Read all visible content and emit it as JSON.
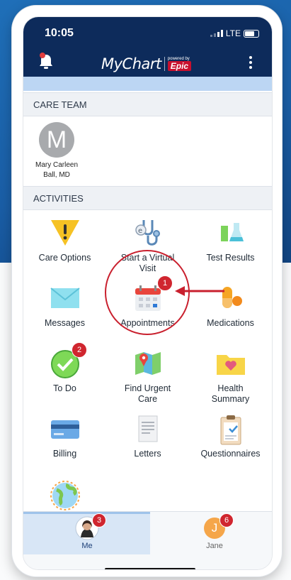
{
  "status_bar": {
    "time": "10:05",
    "carrier": "LTE"
  },
  "header": {
    "logo_text": "MyChart",
    "powered_by": "powered by",
    "brand": "Epic"
  },
  "care_team": {
    "section_label": "CARE TEAM",
    "members": [
      {
        "initial": "M",
        "name": "Mary Carleen Ball, MD"
      }
    ]
  },
  "activities": {
    "section_label": "ACTIVITIES",
    "items": [
      {
        "label": "Care Options",
        "icon": "warning-icon"
      },
      {
        "label": "Start a Virtual Visit",
        "icon": "stethoscope-icon"
      },
      {
        "label": "Test Results",
        "icon": "flask-icon"
      },
      {
        "label": "Messages",
        "icon": "envelope-icon"
      },
      {
        "label": "Appointments",
        "icon": "calendar-icon",
        "badge": "1"
      },
      {
        "label": "Medications",
        "icon": "pills-icon"
      },
      {
        "label": "To Do",
        "icon": "checkmark-icon",
        "badge": "2"
      },
      {
        "label": "Find Urgent Care",
        "icon": "map-icon"
      },
      {
        "label": "Health Summary",
        "icon": "folder-heart-icon"
      },
      {
        "label": "Billing",
        "icon": "credit-card-icon"
      },
      {
        "label": "Letters",
        "icon": "letter-icon"
      },
      {
        "label": "Questionnaires",
        "icon": "clipboard-icon"
      }
    ]
  },
  "tabs": [
    {
      "label": "Me",
      "badge": "3",
      "selected": true
    },
    {
      "label": "Jane",
      "initial": "J",
      "badge": "6",
      "selected": false
    }
  ],
  "colors": {
    "header": "#0d2b5b",
    "accent": "#c9202e",
    "badge": "#d0262f"
  }
}
